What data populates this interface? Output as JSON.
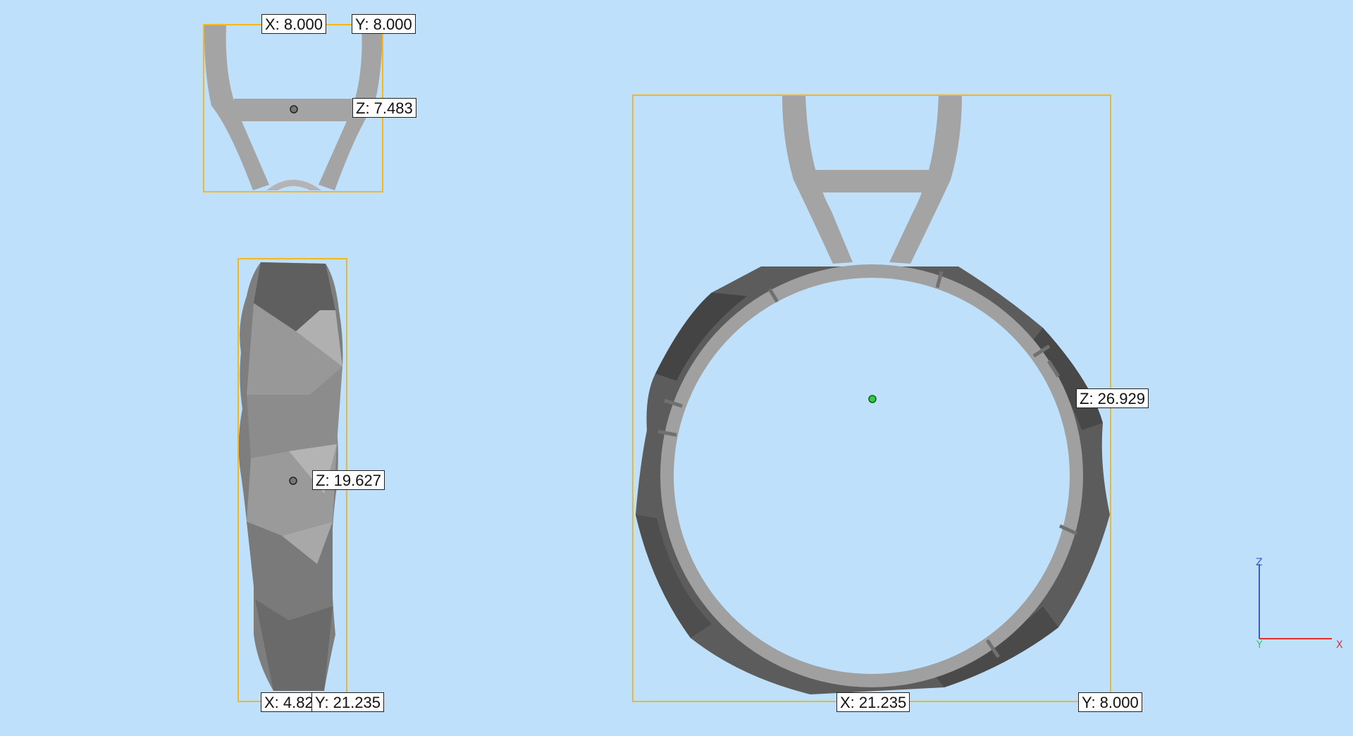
{
  "viewport": {
    "background": "#bee0fa",
    "model_color": "#a4a4a4",
    "model_shadow": "#555555",
    "bbox_color": "#f2b81e",
    "center_marker_color": "#2ecc40"
  },
  "views": {
    "top": {
      "x_label": "X: 8.000",
      "y_label": "Y: 8.000",
      "z_label": "Z: 7.483"
    },
    "side": {
      "z_label": "Z: 19.627",
      "x_label": "X: 4.82",
      "y_label": "Y: 21.235"
    },
    "front": {
      "z_label": "Z: 26.929",
      "x_label": "X: 21.235",
      "y_label": "Y: 8.000"
    }
  },
  "axis_gizmo": {
    "z": "Z",
    "y": "Y",
    "x": "X",
    "z_color": "#3a5bd8",
    "y_color": "#35c46a",
    "x_color": "#e03030"
  }
}
